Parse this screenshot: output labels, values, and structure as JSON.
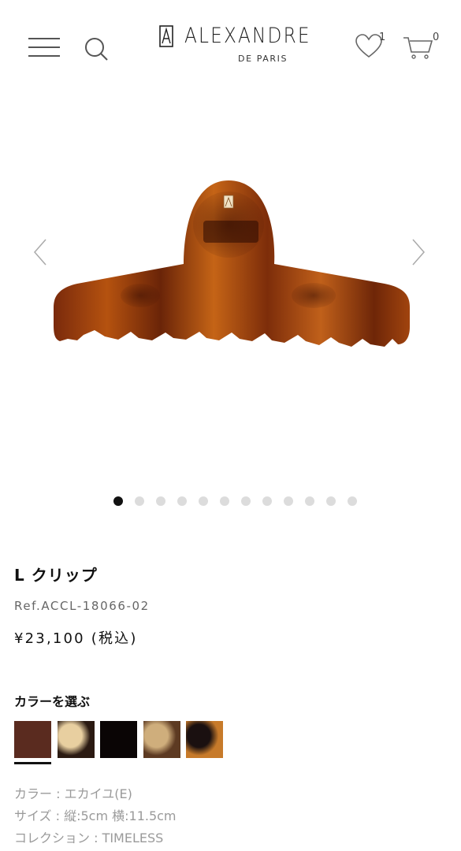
{
  "header": {
    "brand_name": "ALEXANDRE",
    "brand_sub": "DE PARIS",
    "wishlist_count": "1",
    "cart_count": "0"
  },
  "gallery": {
    "image_count": 12,
    "active_index": 0
  },
  "product": {
    "name": "L クリップ",
    "ref": "Ref.ACCL-18066-02",
    "price": "¥23,100 (税込)"
  },
  "color_selector": {
    "heading": "カラーを選ぶ",
    "selected_index": 0,
    "swatches": [
      {
        "name": "swatch-ecaille",
        "colors": [
          "#5a2b1f",
          "#5a2b1f"
        ]
      },
      {
        "name": "swatch-blonde-tortoise",
        "colors": [
          "#e8cfa0",
          "#2b1a12"
        ]
      },
      {
        "name": "swatch-black",
        "colors": [
          "#0a0505",
          "#0a0505"
        ]
      },
      {
        "name": "swatch-beige-tortoise",
        "colors": [
          "#cfae7c",
          "#5d3a22"
        ]
      },
      {
        "name": "swatch-dark-tortoise",
        "colors": [
          "#1a1010",
          "#c77a2a"
        ]
      }
    ]
  },
  "specs": {
    "color": "カラー : エカイユ(E)",
    "size": "サイズ : 縦:5cm 横:11.5cm",
    "collection": "コレクション : TIMELESS"
  }
}
